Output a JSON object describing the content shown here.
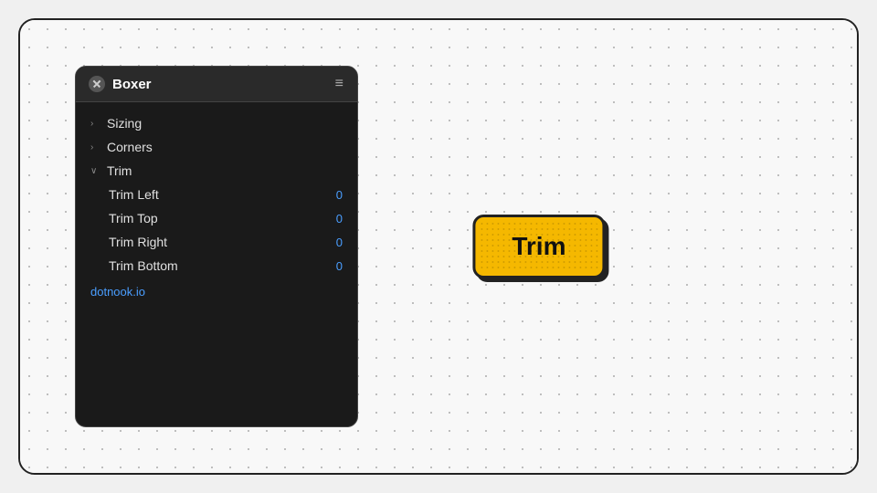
{
  "app": {
    "title": "Boxer",
    "link": "dotnook.io"
  },
  "panel": {
    "header": {
      "title": "Boxer",
      "menu_label": "≡"
    },
    "tree": [
      {
        "label": "Sizing",
        "arrow": "›",
        "expanded": false,
        "children": []
      },
      {
        "label": "Corners",
        "arrow": "›",
        "expanded": false,
        "children": []
      },
      {
        "label": "Trim",
        "arrow": "∨",
        "expanded": true,
        "children": [
          {
            "label": "Trim Left",
            "value": "0"
          },
          {
            "label": "Trim Top",
            "value": "0"
          },
          {
            "label": "Trim Right",
            "value": "0"
          },
          {
            "label": "Trim Bottom",
            "value": "0"
          }
        ]
      }
    ],
    "footer_link": "dotnook.io"
  },
  "canvas": {
    "button_label": "Trim"
  }
}
